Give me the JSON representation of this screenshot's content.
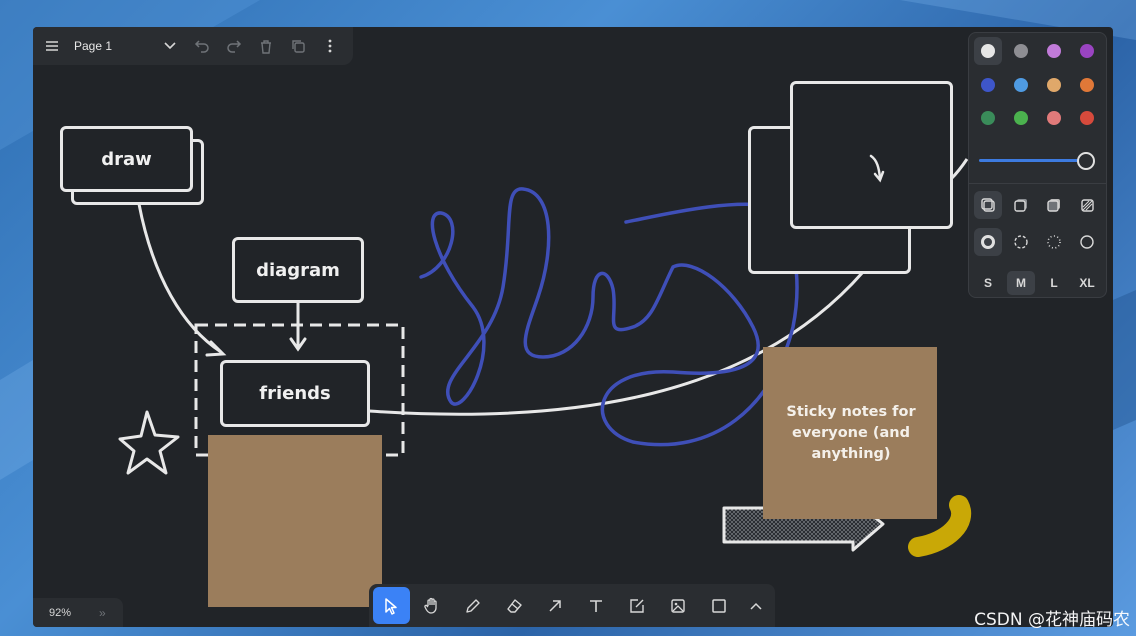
{
  "topbar": {
    "page_name": "Page 1",
    "icons": [
      "menu-icon",
      "chevron-down-icon",
      "undo-icon",
      "redo-icon",
      "trash-icon",
      "duplicate-icon",
      "more-icon"
    ]
  },
  "canvas": {
    "shapes": {
      "draw": "draw",
      "diagram": "diagram",
      "friends": "friends"
    },
    "sticky_note_text": "Sticky notes for everyone (and anything)"
  },
  "style_panel": {
    "colors": [
      "#e6e6e6",
      "#8e8e93",
      "#c17bd9",
      "#9a44c2",
      "#3e56c9",
      "#4f9be2",
      "#e0a86a",
      "#e07838",
      "#3a8c5a",
      "#4bb24e",
      "#e17a7a",
      "#d64a3c"
    ],
    "opacity_percent": 100,
    "sizes": [
      "S",
      "M",
      "L",
      "XL"
    ],
    "selected_size": "M"
  },
  "toolbar": {
    "tools": [
      "select-icon",
      "hand-icon",
      "pencil-icon",
      "eraser-icon",
      "arrow-icon",
      "text-icon",
      "note-icon",
      "image-icon",
      "rectangle-icon",
      "chevron-up-icon"
    ],
    "active_tool": "select-icon"
  },
  "zoom": {
    "value": "92%",
    "expand": "»"
  },
  "watermark": "CSDN @花神庙码农"
}
